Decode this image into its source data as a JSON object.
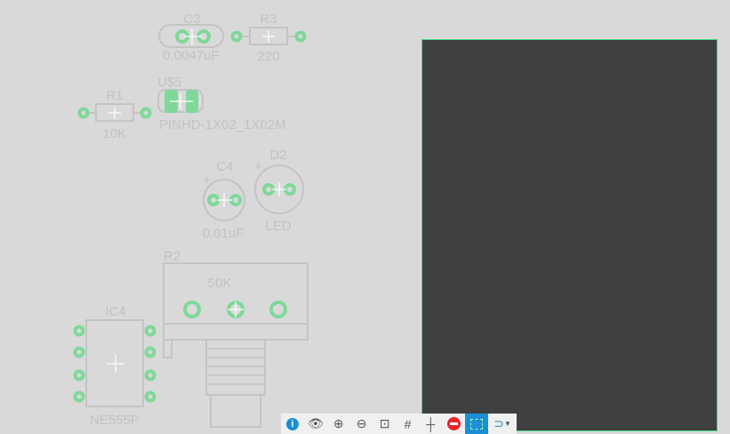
{
  "parts": {
    "c3": {
      "ref": "C3",
      "value": "0.0047uF"
    },
    "r3": {
      "ref": "R3",
      "value": "220"
    },
    "u5": {
      "ref": "U$5",
      "value": "PINHD-1X02_1X02M"
    },
    "r1": {
      "ref": "R1",
      "value": "10K"
    },
    "c4": {
      "ref": "C4",
      "value": "0.01uF",
      "plus": "+"
    },
    "d2": {
      "ref": "D2",
      "value": "LED",
      "plus": "+"
    },
    "r2": {
      "ref": "R2",
      "value": "50K"
    },
    "ic4": {
      "ref": "IC4",
      "value": "NE555P"
    }
  },
  "toolbar": [
    "info",
    "view",
    "zoom-in",
    "zoom-out",
    "fit-in-window",
    "grid",
    "center-cross",
    "delete",
    "select-area",
    "route-dropdown"
  ],
  "colors": {
    "pad": "#7fd89a",
    "board": "#404040",
    "board_outline": "#3fdc8c",
    "active_tool": "#1a8fd6"
  }
}
